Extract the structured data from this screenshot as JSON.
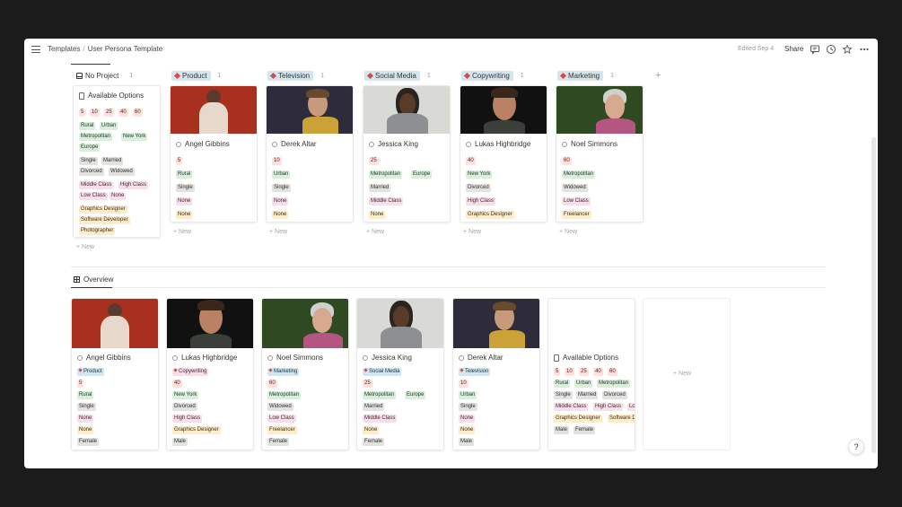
{
  "topbar": {
    "breadcrumb": [
      "Templates",
      "User Persona Template"
    ],
    "breadcrumb_sep": "/",
    "edited": "Edited Sep 4",
    "share": "Share"
  },
  "board": {
    "groups": [
      {
        "label": "No Project",
        "count": "1"
      },
      {
        "label": "Product",
        "count": "1"
      },
      {
        "label": "Television",
        "count": "1"
      },
      {
        "label": "Social Media",
        "count": "1"
      },
      {
        "label": "Copywriting",
        "count": "1"
      },
      {
        "label": "Marketing",
        "count": "1"
      }
    ],
    "new_label": "New",
    "options_card": {
      "title": "Available Options",
      "ages": [
        "5",
        "10",
        "25",
        "40",
        "60"
      ],
      "locations": [
        "Rural",
        "Urban",
        "Metropolitan",
        "New York",
        "Europe"
      ],
      "status": [
        "Single",
        "Married",
        "Divorced",
        "Widowed"
      ],
      "class": [
        "Middle Class",
        "High Class",
        "Low Class",
        "None"
      ],
      "jobs": [
        "Graphics Designer",
        "Software Developer",
        "Photographer"
      ]
    },
    "cards": [
      {
        "name": "Angel Gibbins",
        "age": "5",
        "location": "Rural",
        "status": "Single",
        "class": "None",
        "job": "None"
      },
      {
        "name": "Derek Altar",
        "age": "10",
        "location": "Urban",
        "status": "Single",
        "class": "None",
        "job": "None"
      },
      {
        "name": "Jessica King",
        "age": "25",
        "location": "Metropolitan",
        "location2": "Europe",
        "status": "Married",
        "class": "Middle Class",
        "job": "None"
      },
      {
        "name": "Lukas Highbridge",
        "age": "40",
        "location": "New York",
        "status": "Divorced",
        "class": "High Class",
        "job": "Graphics Designer"
      },
      {
        "name": "Noel Simmons",
        "age": "60",
        "location": "Metropolitan",
        "status": "Widowed",
        "class": "Low Class",
        "job": "Freelancer"
      }
    ]
  },
  "overview": {
    "tab": "Overview",
    "new_label": "New",
    "cards": [
      {
        "name": "Angel Gibbins",
        "project": "Product",
        "age": "5",
        "location": "Rural",
        "status": "Single",
        "class": "None",
        "job": "None",
        "gender": "Female"
      },
      {
        "name": "Lukas Highbridge",
        "project": "Copywriting",
        "age": "40",
        "location": "New York",
        "status": "Divorced",
        "class": "High Class",
        "job": "Graphics Designer",
        "gender": "Male"
      },
      {
        "name": "Noel Simmons",
        "project": "Marketing",
        "age": "60",
        "location": "Metropolitan",
        "status": "Widowed",
        "class": "Low Class",
        "job": "Freelancer",
        "gender": "Female"
      },
      {
        "name": "Jessica King",
        "project": "Social Media",
        "age": "25",
        "location": "Metropolitan",
        "location2": "Europe",
        "status": "Married",
        "class": "Middle Class",
        "job": "None",
        "gender": "Female"
      },
      {
        "name": "Derek Altar",
        "project": "Television",
        "age": "10",
        "location": "Urban",
        "status": "Single",
        "class": "None",
        "job": "None",
        "gender": "Male"
      }
    ],
    "options_card": {
      "title": "Available Options",
      "ages": [
        "5",
        "10",
        "25",
        "40",
        "60"
      ],
      "locations": [
        "Rural",
        "Urban",
        "Metropolitan",
        "Lo"
      ],
      "status": [
        "Single",
        "Married",
        "Divorced"
      ],
      "class": [
        "Middle Class",
        "High Class",
        "Lo"
      ],
      "jobs": [
        "Graphics Designer",
        "Software D"
      ],
      "gender": [
        "Male",
        "Female"
      ]
    }
  },
  "help": "?",
  "colors": {
    "tag_red": "#ffe2dd",
    "tag_green": "#dbeddb",
    "tag_pink": "#f5e0e9",
    "tag_yellow": "#fdecc8",
    "tag_blue": "#d3e5ef",
    "tag_gray": "#e3e2e0",
    "project_diamond": "#d44c47"
  },
  "icons": {
    "menu": "hamburger-icon",
    "comment": "comment-icon",
    "history": "clock-icon",
    "favorite": "star-icon",
    "more": "more-icon",
    "person": "person-icon",
    "document": "document-icon",
    "table": "table-icon",
    "add": "plus-icon"
  }
}
